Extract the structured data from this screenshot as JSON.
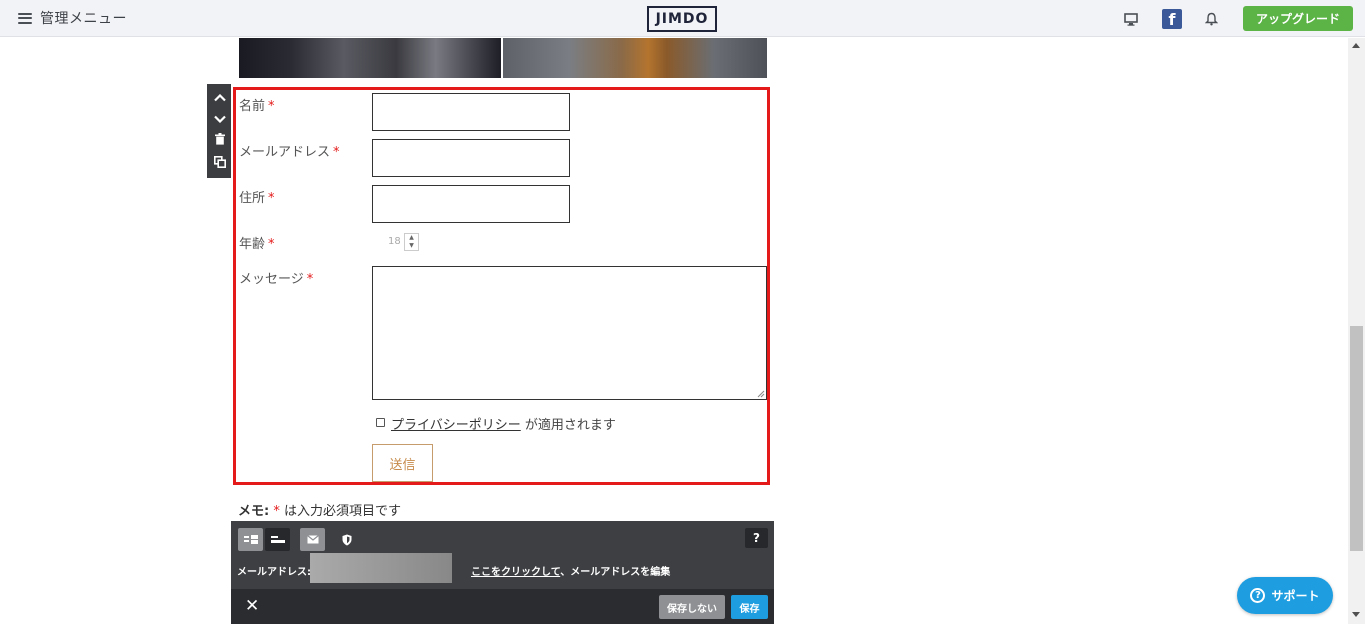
{
  "topbar": {
    "menu_label": "管理メニュー",
    "logo": "JIMDO",
    "facebook_glyph": "f",
    "upgrade_label": "アップグレード"
  },
  "form": {
    "required_mark": "*",
    "fields": [
      {
        "label": "名前"
      },
      {
        "label": "メールアドレス"
      },
      {
        "label": "住所"
      },
      {
        "label": "年齢",
        "value": "18"
      },
      {
        "label": "メッセージ"
      }
    ],
    "privacy_link": "プライバシーポリシー",
    "privacy_suffix": " が適用されます",
    "submit_label": "送信",
    "memo_prefix": "メモ:",
    "memo_mark": "*",
    "memo_text": " は入力必須項目です"
  },
  "toolbar": {
    "help_label": "?",
    "email_label": "メールアドレス:",
    "edit_link": "ここをクリックして",
    "edit_suffix": "、メールアドレスを編集"
  },
  "footer": {
    "close_label": "✕",
    "no_save_label": "保存しない",
    "save_label": "保存"
  },
  "support": {
    "label": "サポート",
    "icon_glyph": "?"
  },
  "colors": {
    "accent_red": "#e41919",
    "upgrade_green": "#5cb346",
    "save_blue": "#1e9ee0"
  },
  "icons": [
    "hamburger-icon",
    "desktop-icon",
    "facebook-icon",
    "bell-icon",
    "chevron-up-icon",
    "chevron-down-icon",
    "trash-icon",
    "copy-icon",
    "layout-label-left-icon",
    "layout-label-top-icon",
    "mail-icon",
    "shield-icon",
    "help-icon",
    "close-icon",
    "question-circle-icon"
  ]
}
